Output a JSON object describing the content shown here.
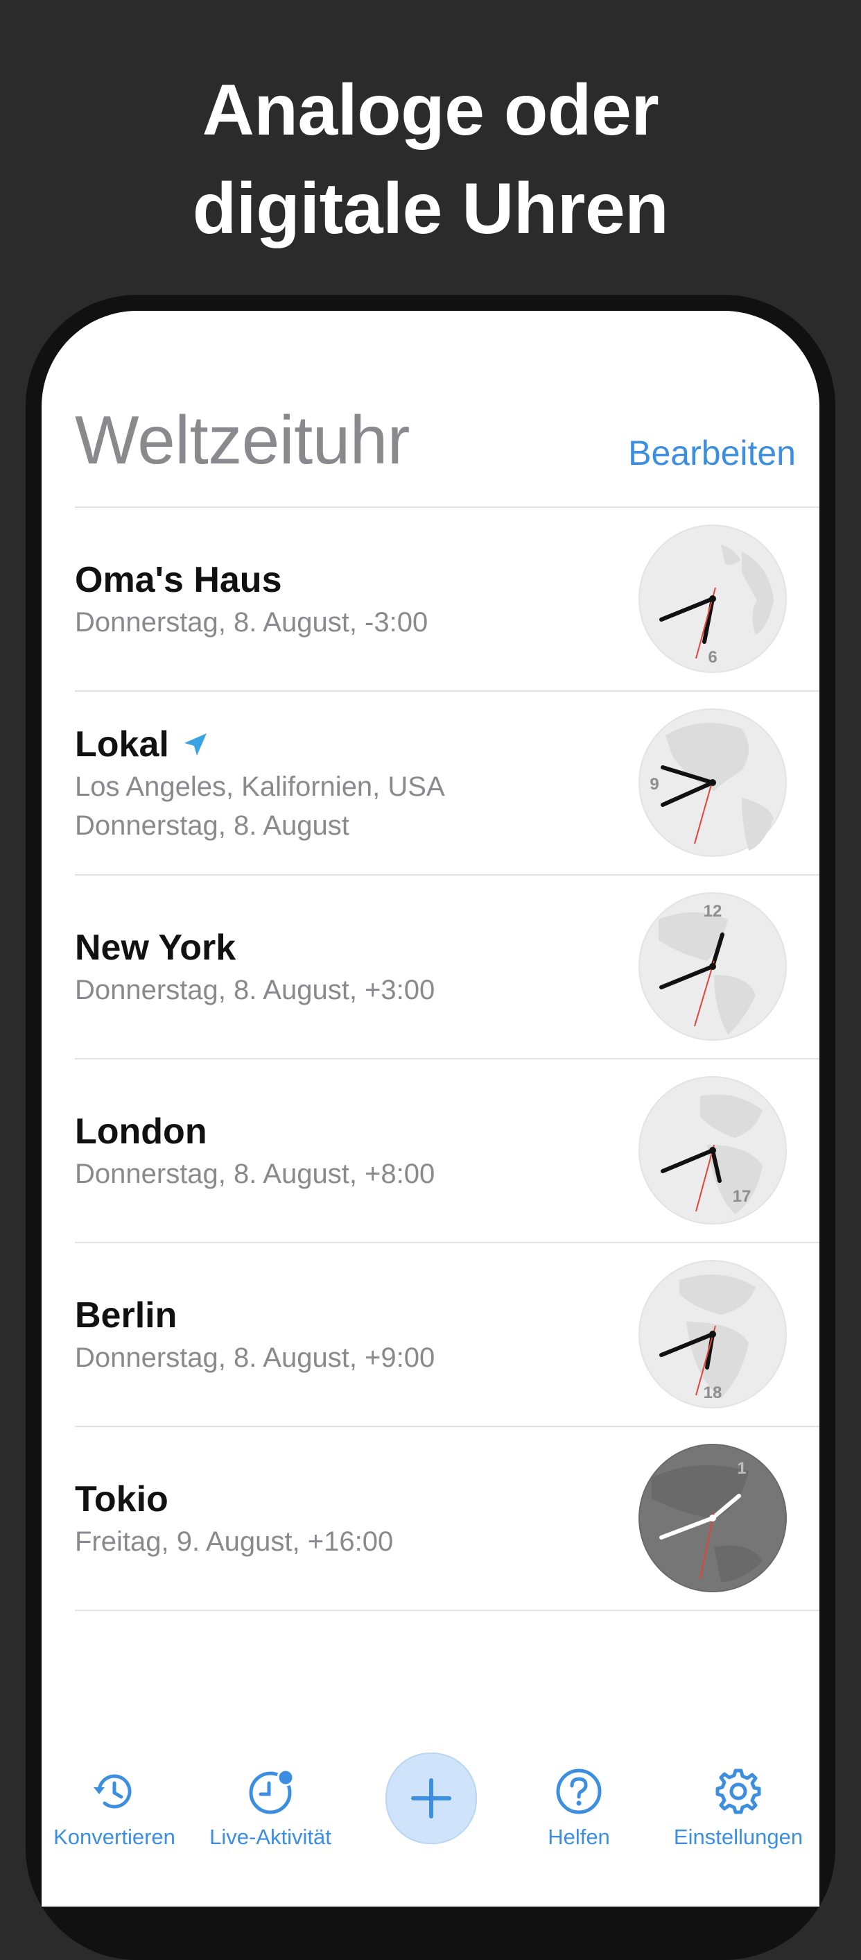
{
  "headline": {
    "line1": "Analoge oder",
    "line2": "digitale Uhren"
  },
  "nav": {
    "title": "Weltzeituhr",
    "edit_label": "Bearbeiten"
  },
  "clocks": [
    {
      "name": "Oma's Haus",
      "line1": "Donnerstag, 8. August, -3:00",
      "line2": "",
      "hour_label": "6",
      "dark": false,
      "location_icon": false
    },
    {
      "name": "Lokal",
      "line1": "Los Angeles, Kalifornien, USA",
      "line2": "Donnerstag, 8. August",
      "hour_label": "9",
      "dark": false,
      "location_icon": true
    },
    {
      "name": "New York",
      "line1": "Donnerstag, 8. August, +3:00",
      "line2": "",
      "hour_label": "12",
      "dark": false,
      "location_icon": false
    },
    {
      "name": "London",
      "line1": "Donnerstag, 8. August, +8:00",
      "line2": "",
      "hour_label": "17",
      "dark": false,
      "location_icon": false
    },
    {
      "name": "Berlin",
      "line1": "Donnerstag, 8. August, +9:00",
      "line2": "",
      "hour_label": "18",
      "dark": false,
      "location_icon": false
    },
    {
      "name": "Tokio",
      "line1": "Freitag, 9. August, +16:00",
      "line2": "",
      "hour_label": "1",
      "dark": true,
      "location_icon": false
    }
  ],
  "tabbar": {
    "convert_label": "Konvertieren",
    "live_label": "Live-Aktivität",
    "help_label": "Helfen",
    "settings_label": "Einstellungen",
    "add_icon": "plus-icon"
  },
  "colors": {
    "accent": "#3c8ee0",
    "location_arrow": "#3aa3e3",
    "second_hand": "#e0443a",
    "background": "#2b2b2b"
  }
}
